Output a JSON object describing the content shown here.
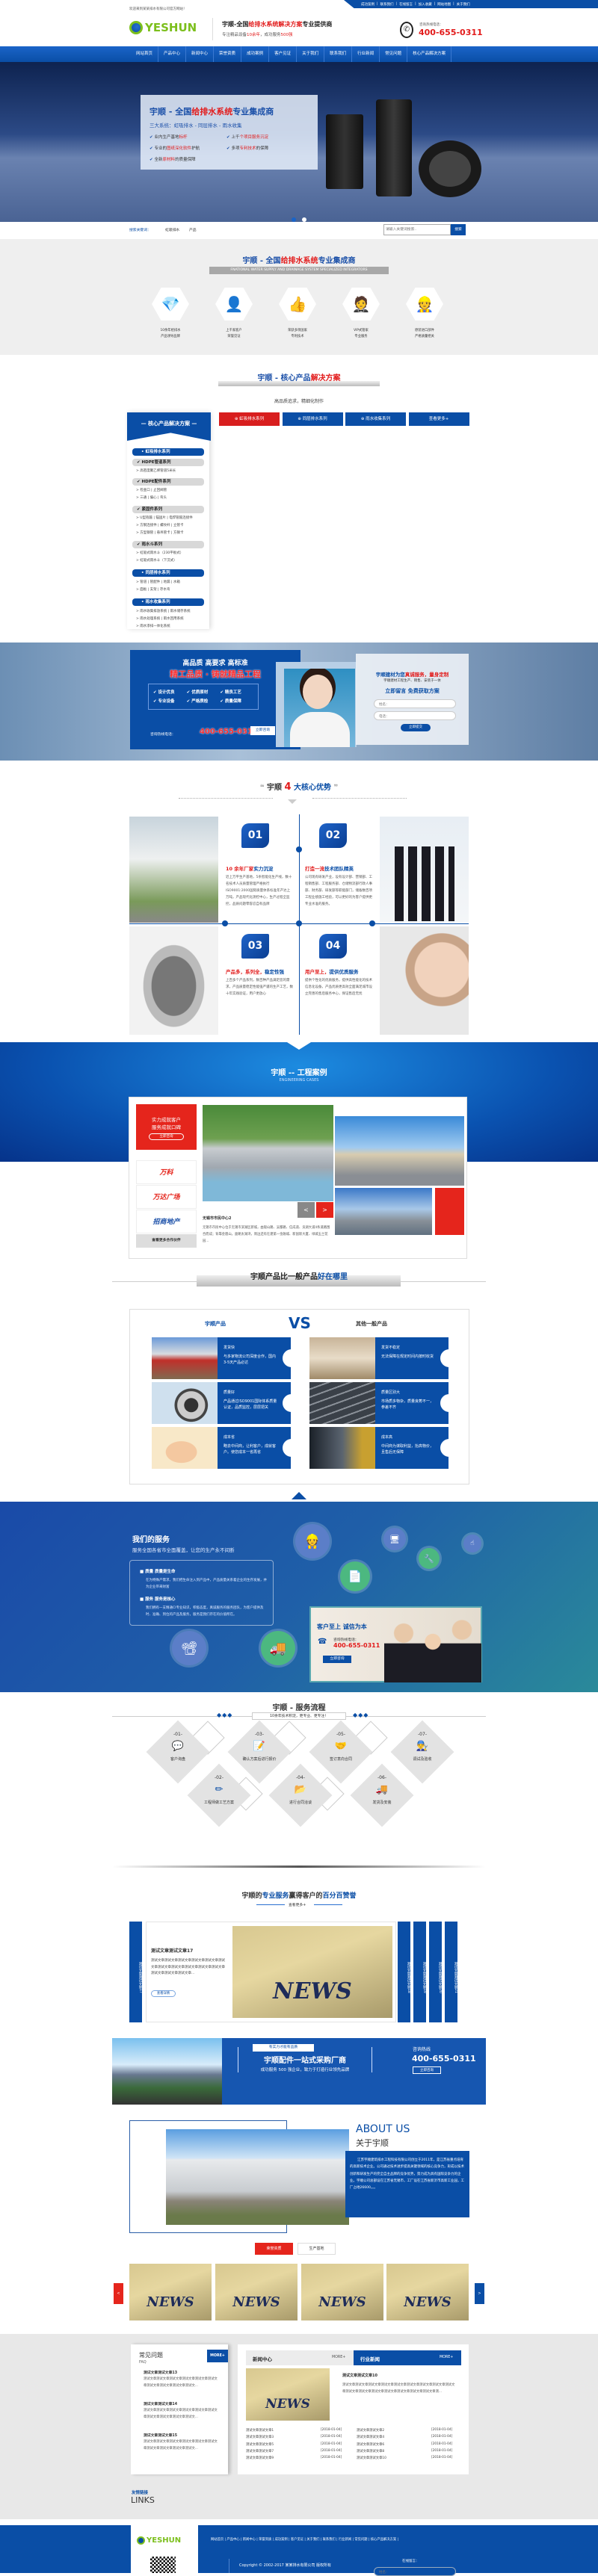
{
  "colors": {
    "brand_blue": "#0a4ea6",
    "accent_red": "#e21b1b",
    "logo_green": "#7cbf1c"
  },
  "topbar": {
    "welcome": "欢迎来到某某排水有限公司官方网站！",
    "links": [
      "成功案例",
      "联系我们",
      "在线留言",
      "加入收藏",
      "网站地图",
      "关于我们"
    ]
  },
  "header": {
    "logo_text": "YESHUN",
    "slogan_a": "宇顺-全国",
    "slogan_b": "给排水系统解决方案",
    "slogan_c": "专业提供商",
    "sub_a": "专注精品设备",
    "sub_b": "10余年",
    "sub_c": "，成功服务",
    "sub_d": "500强",
    "hotline_label": "咨询热线电话：",
    "hotline": "400-655-0311",
    "phone_icon": "phone-icon"
  },
  "nav": [
    "网站首页",
    "产品中心",
    "新闻中心",
    "荣誉资质",
    "成功案例",
    "客户见证",
    "关于我们",
    "联系我们",
    "行业新闻",
    "常见问题",
    "核心产品解决方案"
  ],
  "banner": {
    "title_a": "宇顺 - 全国",
    "title_b": "给排水系统",
    "title_c": "专业集成商",
    "subtitle": "三大系统：虹吸排水 - 同层排水 - 雨水收集",
    "checks": [
      [
        "业内生产基地",
        "标杆"
      ],
      [
        "上千",
        "个项目服务沉淀"
      ],
      [
        "专业的",
        "图纸深化软件",
        "护航"
      ],
      [
        "多项",
        "专利技术",
        "的保障"
      ],
      [
        "全新",
        "原材料",
        "的质量保障"
      ]
    ],
    "dots": 2,
    "active_dot": 1
  },
  "search": {
    "label": "搜索关键词：",
    "keywords": [
      "虹吸排水",
      "产品"
    ],
    "placeholder": "请输入关键词搜索..",
    "button": "搜索"
  },
  "integrator": {
    "title_a": "宇顺 - 全国",
    "title_b": "给排水系统",
    "title_c": "专业集成商",
    "english": "FNATIONAL WATER SUPPLY AND DRAINAGE SYSTEM SPECIALIZED INTEGRATORS",
    "items": [
      {
        "icon": "diamond-icon",
        "l1": "10余年给排水",
        "l2": "产品领导品牌"
      },
      {
        "icon": "user-icon",
        "l1": "上千家客户",
        "l2": "荣誉见证"
      },
      {
        "icon": "thumbs-up-icon",
        "l1": "荣获多项国家",
        "l2": "专利技术"
      },
      {
        "icon": "butler-icon",
        "l1": "VIP式管家",
        "l2": "专业服务"
      },
      {
        "icon": "worker-icon",
        "l1": "原装进口部件",
        "l2": "严格质量把关"
      }
    ]
  },
  "core": {
    "title_a": "宇顺 - 核心产品",
    "title_b": "解决方案",
    "subtitle": "高品质追求，精细化制作",
    "tabs": [
      "虹吸排水系列",
      "同层排水系列",
      "雨水收集系列",
      "查看更多+"
    ],
    "active_tab": 0,
    "sidebar_title": "核心产品解决方案",
    "sidebar": [
      {
        "type": "h",
        "label": "虹吸排水系列"
      },
      {
        "type": "g",
        "label": "HDPE管道系列"
      },
      {
        "type": "i",
        "label": "高密度聚乙烯管道5米长"
      },
      {
        "type": "g",
        "label": "HDPE配件系列"
      },
      {
        "type": "i",
        "label": "检查口 | 止回阀管"
      },
      {
        "type": "i",
        "label": "三通 | 偏心 | 弯头"
      },
      {
        "type": "g",
        "label": "紧固件系列"
      },
      {
        "type": "i",
        "label": "U型抱箍 | 锚固片 | 电焊管箍连接件"
      },
      {
        "type": "i",
        "label": "方钢连接件 | 螺纹杆 | 立管卡"
      },
      {
        "type": "i",
        "label": "方型钢管 | 悬吊管卡 | 方钢卡"
      },
      {
        "type": "g",
        "label": "雨水斗系列"
      },
      {
        "type": "i",
        "label": "虹吸式雨水斗（230平板式）"
      },
      {
        "type": "i",
        "label": "虹吸式雨水斗（下沉式）"
      },
      {
        "type": "h",
        "label": "同层排水系列"
      },
      {
        "type": "i",
        "label": "管道 | 管配件 | 地漏 | 水箱"
      },
      {
        "type": "i",
        "label": "面板 | 支架 | 存水弯"
      },
      {
        "type": "h",
        "label": "雨水收集系列"
      },
      {
        "type": "i",
        "label": "雨水收集排放系统 | 雨水储存系统"
      },
      {
        "type": "i",
        "label": "雨水处理系统 | 雨水回用系统"
      },
      {
        "type": "i",
        "label": "雨水渗排一体化系统"
      }
    ]
  },
  "promo": {
    "line1": "高品质 高要求 高标准",
    "line2": "精工品质 · 铸就精品工程",
    "features": [
      "设计优良",
      "优质原材",
      "精良工艺",
      "专业设备",
      "严格质检",
      "质量保障"
    ],
    "hotline_label": "咨询热线电话：",
    "hotline": "400-655-0311",
    "consult_btn": "立即咨询",
    "form_title_a": "宇顺建材为您",
    "form_title_b": "真诚服务，量身定制",
    "form_sub": "宇顺建材工程生产、销售、安装于一体",
    "form_cta": "立即留言  免费获取方案",
    "name_placeholder": "姓名：",
    "phone_placeholder": "电话：",
    "submit": "立即提交"
  },
  "advantages": {
    "title_a": "宇顺",
    "title_num": "4",
    "title_b": "大核心优势",
    "items": [
      {
        "num": "01",
        "t_red": "10 余年厂家",
        "t_blue": "实力沉淀",
        "text": "近上万平生产基地，5条智能化生产线，数十名技术人员质量管理严格执行ISO9001:2000国际质量体系标准年产达上万吨，产品现代化测控中心，生产过程全监控，品质问题零容忍自有品牌"
      },
      {
        "num": "02",
        "t_red": "打造一流",
        "t_blue": "技术团队精英",
        "text": "公司现有研发产业，设有设计部、营销部、工程销售部、工程服务部、仓储物流部行政人事部、财务部、研发部等职能部门，储备数百项工程业绩施工经验，可以更好的为客户提供更专业水准的服务。"
      },
      {
        "num": "03",
        "t_red": "产品多，系列全，",
        "t_blue": "稳定性强",
        "text": "上百多个产品系列，数百种产品满足您的需求，产品质量稳定性能强严谨的生产工艺，数十年实践验证，用户更放心"
      },
      {
        "num": "04",
        "t_red": "用户至上，",
        "t_blue": "提供优质服务",
        "text": "提供个性化的优质服务，提供高性能化的技术信息化设备，产品优质更高效全面满足城市设立完善的售后服务中心，保证售后无忧"
      }
    ]
  },
  "cases": {
    "title": "宇顺 -- 工程案例",
    "english": "ENGINEERING CASES",
    "promo_l1": "实力成就客户",
    "promo_l2": "服务成就口碑",
    "promo_btn": "立即咨询",
    "partners": [
      "万科",
      "万达广场",
      "招商地产"
    ],
    "partners_more": "查看更多合作伙伴",
    "case_title": "无锡市市民中心2",
    "case_text": "无锡市市民中心位于无锡市滨湖区新城，由观山路、吴都路、信成道、贡湖大道4条道路围合而成；背靠金匮山，面朝太湖湾，周边还有在建第一金融城、新国际大厦、绿城玉兰花园...",
    "prev": "<",
    "next": ">"
  },
  "compare": {
    "title_a": "宇顺产品比一般产品",
    "title_b": "好在哪里",
    "left_head": "宇顺产品",
    "vs": "VS",
    "right_head": "其他一般产品",
    "left": [
      {
        "t": "发货快",
        "d": "与多家物流公司深度合作，国内3-5天产品必达"
      },
      {
        "t": "质量好",
        "d": "产品通过ISO9001国际体系质量认证，品质监控，层层把关"
      },
      {
        "t": "成本省",
        "d": "略去中间商，让利客户，成就客户。使您成本一省再省"
      }
    ],
    "right": [
      {
        "t": "发货不稳定",
        "d": "无法保障在规定时间内按时收货"
      },
      {
        "t": "质量区别大",
        "d": "市场质多物杂，质量良莠不一，参差不齐"
      },
      {
        "t": "成本高",
        "d": "中间商为谋取利益，抬高物价，且售后无保障"
      }
    ]
  },
  "services": {
    "title": "我们的服务",
    "subtitle": "服务全国各省市全面覆盖，让您的生产永不间断",
    "items": [
      {
        "h": "质量  质量是生命",
        "d": "在为特殊产需求，我们把生命注入到产品中，产品质量关系着企业的生存发展，并为企业带来财富"
      },
      {
        "h": "服务  服务是核心",
        "d": "我们拥有一支精通CI专业知识，积极态度，真诚服务的服务团队，为客户提供及时、准确、到位的产品及服务，服务是我们存在的价值所在。"
      }
    ],
    "card_title": "客户至上  诚信为本",
    "card_label": "咨询热线电话：",
    "card_phone": "400-655-0311",
    "card_btn": "立即咨询"
  },
  "process": {
    "title": "宇顺 - 服务流程",
    "subtitle": "10余年技术积淀，更专业、更专注！",
    "steps": [
      {
        "n": "-01-",
        "icon": "chat-icon",
        "l": "客户询盘"
      },
      {
        "n": "-02-",
        "icon": "design-tools-icon",
        "l": "工程师做工艺方案"
      },
      {
        "n": "-03-",
        "icon": "contract-sign-icon",
        "l": "确认方案后进行报价"
      },
      {
        "n": "-04-",
        "icon": "folder-icon",
        "l": "进行合同洽谈"
      },
      {
        "n": "-05-",
        "icon": "handshake-icon",
        "l": "签订意向合同"
      },
      {
        "n": "-06-",
        "icon": "delivery-truck-icon",
        "l": "发货及安装"
      },
      {
        "n": "-07-",
        "icon": "engineer-icon",
        "l": "调试及验收"
      }
    ]
  },
  "testimonials": {
    "title_a": "宇顺的",
    "title_b": "专业服务",
    "title_c": "赢得客户的",
    "title_d": "百分百赞誉",
    "more": "查看更多+",
    "first_strip": "测试文章测试文章17",
    "article_title": "测试文章测试文章17",
    "article_text": "测试文章测试文章测试文章测试文章测试文章测试文章测试文章测试文章测试文章测试文章测试文章测试文章测试文章测试文章...",
    "details_btn": "查看详情",
    "strips": [
      "测试文章测试文章18",
      "测试文章测试文章19",
      "测试文章测试文章20",
      "测试文章测试文章21"
    ],
    "news_word": "NEWS"
  },
  "banner2": {
    "tag": "有实力才能有品质",
    "title": "宇顺配件一站式采购厂商",
    "sub": "成功服务 500 强企业，致力于打造行业领先品牌",
    "hotline_label": "咨询热线",
    "hotline": "400-655-0311",
    "btn": "立即咨询"
  },
  "about": {
    "en": "ABOUT US",
    "cn": "关于宇顺",
    "text": "江苏宇顺建筑排水工程科技有限公司创立于2011年，是江苏省重点培育的高新技术企业。公司通过技术进步提高关键领域的核心竞争力，形成以技术创新和研发生产的完全自主品牌的竞争优势，努力成为具有国际竞争力的企业。宇顺公司总部设在江苏省无锡市，工厂设在江苏省新沂市高新工业园，工厂占地26600。。。"
  },
  "gallery": {
    "tabs": [
      "荣誉资质",
      "生产基地"
    ],
    "active_tab": 0,
    "prev": "<",
    "next": ">",
    "items": [
      "NEWS",
      "NEWS",
      "NEWS",
      "NEWS"
    ]
  },
  "faq": {
    "title": "常见问题",
    "en": "FAQ",
    "more": "MORE+",
    "items": [
      {
        "t": "测试文章测试文章13",
        "d": "测试文章测试文章测试文章测试文章测试文章测试文章测试文章测试文章测试文章测试文..."
      },
      {
        "t": "测试文章测试文章14",
        "d": "测试文章测试文章测试文章测试文章测试文章测试文章测试文章测试文章测试文章测试文..."
      },
      {
        "t": "测试文章测试文章15",
        "d": "测试文章测试文章测试文章测试文章测试文章测试文章测试文章测试文章测试文章测试文..."
      }
    ]
  },
  "news": {
    "tab1": "新闻中心",
    "tab2": "行业新闻",
    "more": "MORE+",
    "feature_title": "测试文章测试文章10",
    "feature_text": "测试文章测试文章测试文章测试文章测试文章测试文章测试文章测试文章测试文章测试文章测试文章测试文章测试文章测试文章测试文章测试文章测...",
    "list": [
      [
        "测试文章测试文章1",
        "[2018-01-04]"
      ],
      [
        "测试文章测试文章2",
        "[2018-01-04]"
      ],
      [
        "测试文章测试文章3",
        "[2018-01-04]"
      ],
      [
        "测试文章测试文章4",
        "[2018-01-04]"
      ],
      [
        "测试文章测试文章5",
        "[2018-01-04]"
      ],
      [
        "测试文章测试文章6",
        "[2018-01-04]"
      ],
      [
        "测试文章测试文章7",
        "[2018-01-04]"
      ],
      [
        "测试文章测试文章8",
        "[2018-01-04]"
      ],
      [
        "测试文章测试文章9",
        "[2018-01-04]"
      ],
      [
        "测试文章测试文章10",
        "[2018-01-04]"
      ]
    ]
  },
  "links": {
    "cn": "友情链接",
    "en": "LINKS"
  },
  "footer": {
    "logo_text": "YESHUN",
    "nav": [
      "网站首页",
      "产品中心",
      "新闻中心",
      "荣誉资质",
      "成功案例",
      "客户见证",
      "关于我们",
      "联系我们",
      "行业新闻",
      "常见问题",
      "核心产品解决方案"
    ],
    "copyright": "Copyright © 2002-2017 某某排水有限公司 版权所有",
    "message_label": "在线留言：",
    "name_placeholder": "姓名："
  }
}
